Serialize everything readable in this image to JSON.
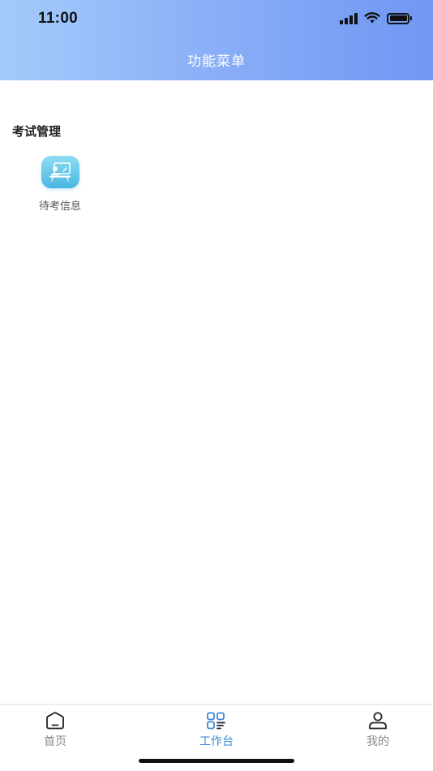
{
  "status_bar": {
    "time": "11:00",
    "icons": [
      "signal-icon",
      "wifi-icon",
      "battery-icon"
    ]
  },
  "nav": {
    "title": "功能菜单"
  },
  "sections": [
    {
      "title": "考试管理",
      "items": [
        {
          "label": "待考信息",
          "icon": "classroom-icon"
        }
      ]
    }
  ],
  "tabbar": {
    "tabs": [
      {
        "label": "首页",
        "icon": "home-icon",
        "active": false
      },
      {
        "label": "工作台",
        "icon": "workbench-icon",
        "active": true
      },
      {
        "label": "我的",
        "icon": "user-icon",
        "active": false
      }
    ]
  },
  "colors": {
    "header_start": "#a4cbfb",
    "header_end": "#6f97f3",
    "active_tab": "#3a86d8",
    "inactive_tab": "#8a8a8a",
    "icon_tile_top": "#8fdcf2",
    "icon_tile_bottom": "#4ab6e2"
  }
}
